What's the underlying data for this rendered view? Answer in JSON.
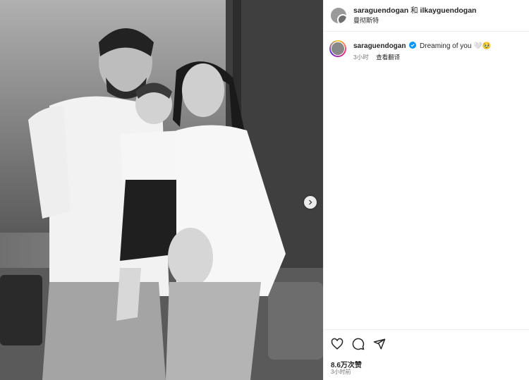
{
  "header": {
    "username": "saraguendogan",
    "conjunction": "和",
    "collaborator": "ilkayguendogan",
    "location": "曼彻斯特"
  },
  "caption": {
    "username": "saraguendogan",
    "text": "Dreaming of you 🤍🥹",
    "time": "3小时",
    "translate": "查看翻译"
  },
  "stats": {
    "views": "8.6万次赞",
    "time": "3小时前"
  },
  "icons": {
    "like": "heart-icon",
    "comment": "comment-icon",
    "share": "paper-plane-icon",
    "next": "chevron-right-icon",
    "verified": "verified-badge-icon"
  },
  "colors": {
    "verified": "#0095f6",
    "text": "#262626",
    "muted": "#737373"
  }
}
